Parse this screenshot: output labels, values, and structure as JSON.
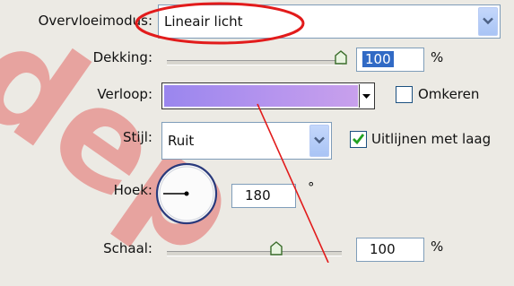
{
  "blend_mode": {
    "label": "Overvloeimodus:",
    "value": "Lineair licht"
  },
  "opacity": {
    "label": "Dekking:",
    "value": "100",
    "unit": "%",
    "level": 1.0
  },
  "gradient": {
    "label": "Verloop:",
    "colors": [
      "#9a86ee",
      "#c8a0ec"
    ]
  },
  "reverse": {
    "label": "Omkeren",
    "checked": false
  },
  "style": {
    "label": "Stijl:",
    "value": "Ruit"
  },
  "align": {
    "label": "Uitlijnen met laag",
    "checked": true
  },
  "angle": {
    "label": "Hoek:",
    "value": "180",
    "unit": "°",
    "degrees": 180
  },
  "scale": {
    "label": "Schaal:",
    "value": "100",
    "unit": "%",
    "level": 0.6
  },
  "watermark": "depositphotos",
  "colors": {
    "accent_select": "#316ac5",
    "annotation_red": "#e21b1b",
    "combo_button": "#b4ccf7"
  }
}
